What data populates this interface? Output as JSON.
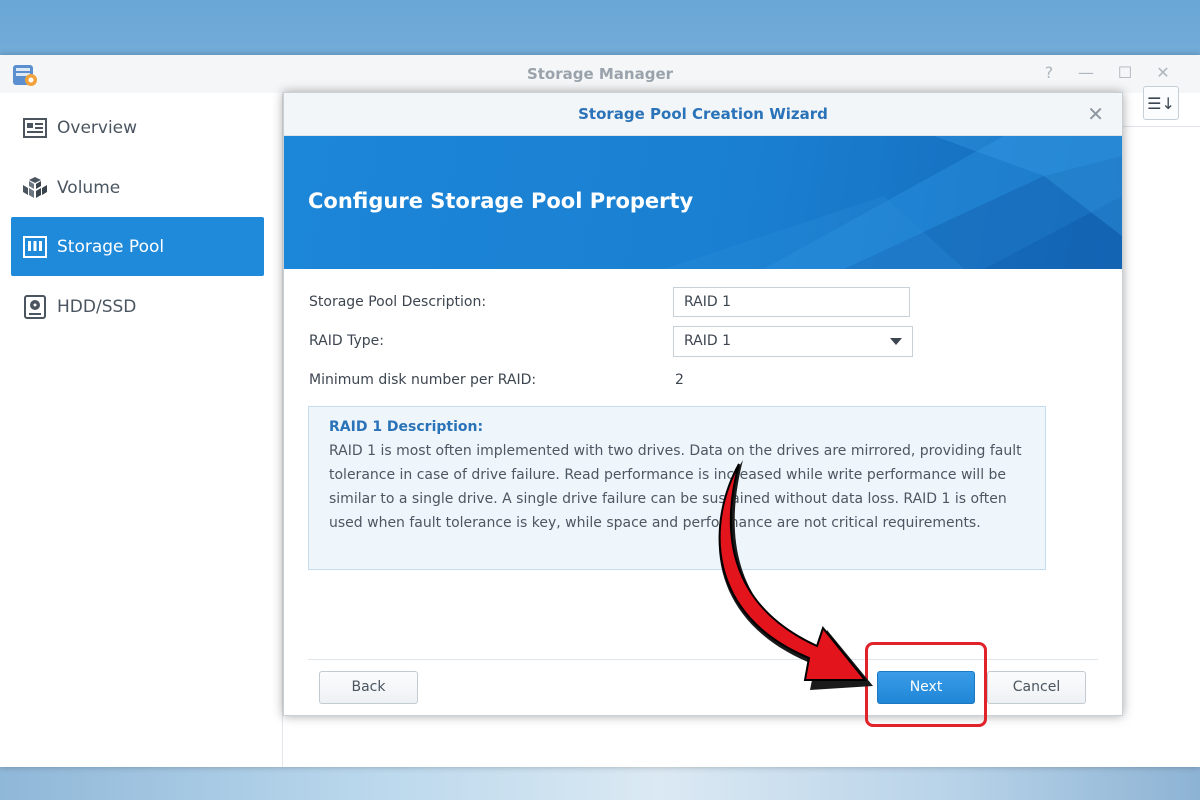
{
  "app": {
    "title": "Storage Manager",
    "controls": {
      "help": "?",
      "minimize": "—",
      "maximize": "☐",
      "close": "✕"
    }
  },
  "sidebar": {
    "items": [
      {
        "label": "Overview",
        "icon": "overview-icon",
        "active": false
      },
      {
        "label": "Volume",
        "icon": "volume-icon",
        "active": false
      },
      {
        "label": "Storage Pool",
        "icon": "storage-pool-icon",
        "active": true
      },
      {
        "label": "HDD/SSD",
        "icon": "hdd-icon",
        "active": false
      }
    ]
  },
  "toolbar": {
    "sort_icon": "☰↓"
  },
  "wizard": {
    "title": "Storage Pool Creation Wizard",
    "close": "✕",
    "banner_title": "Configure Storage Pool Property",
    "fields": {
      "description_label": "Storage Pool Description:",
      "description_value": "RAID 1",
      "raid_type_label": "RAID Type:",
      "raid_type_value": "RAID 1",
      "min_disk_label": "Minimum disk number per RAID:",
      "min_disk_value": "2"
    },
    "description_box": {
      "title": "RAID 1 Description:",
      "text": "RAID 1 is most often implemented with two drives. Data on the drives are mirrored, providing fault tolerance in case of drive failure. Read performance is increased while write performance will be similar to a single drive. A single drive failure can be sustained without data loss. RAID 1 is often used when fault tolerance is key, while space and performance are not critical requirements."
    },
    "buttons": {
      "back": "Back",
      "next": "Next",
      "cancel": "Cancel"
    }
  },
  "colors": {
    "accent": "#1f8ad9",
    "banner": "#1a7fd1",
    "highlight": "#e0222b"
  }
}
